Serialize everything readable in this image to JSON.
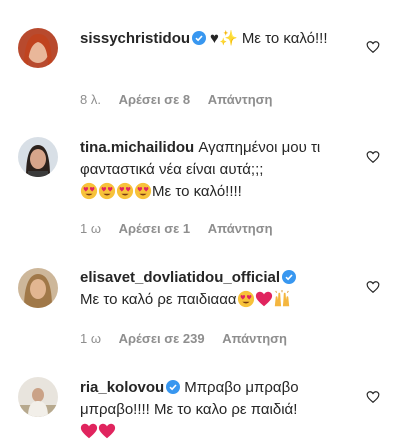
{
  "comments": [
    {
      "username": "sissychristidou",
      "verified": true,
      "text_before": "♥✨",
      "text_main": "Με το καλό!!!",
      "time": "8 λ.",
      "likes": "Αρέσει σε 8",
      "reply": "Απάντηση"
    },
    {
      "username": "tina.michailidou",
      "verified": false,
      "text_main": "Αγαπημένοι μου τι φανταστικά νέα είναι αυτά;;;",
      "text_after": "Με το καλό!!!!",
      "time": "1 ω",
      "likes": "Αρέσει σε 1",
      "reply": "Απάντηση"
    },
    {
      "username": "elisavet_dovliatidou_official",
      "verified": true,
      "text_main": "Με το καλό ρε παιδιααα",
      "time": "1 ω",
      "likes": "Αρέσει σε 239",
      "reply": "Απάντηση"
    },
    {
      "username": "ria_kolovou",
      "verified": true,
      "text_main": "Μπραβο μπραβο μπραβο!!!! Με το καλο ρε παιδιά!"
    }
  ],
  "colors": {
    "text": "#262626",
    "muted": "#8e8e8e",
    "verified_blue": "#3897f0",
    "emoji_red": "#e0245e"
  },
  "icons": [
    "verified-badge-icon",
    "heart-outline-icon",
    "heart-eyes-emoji",
    "red-heart-emoji",
    "raised-hands-emoji",
    "sparkles-emoji",
    "black-heart-emoji"
  ]
}
